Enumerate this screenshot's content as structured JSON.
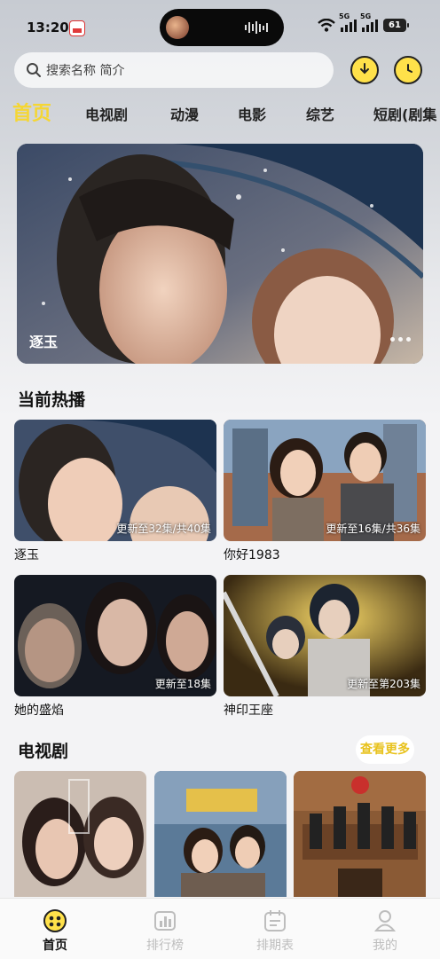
{
  "status_bar": {
    "time": "13:20",
    "network_1": "5G",
    "network_2": "5G",
    "battery": "61"
  },
  "search": {
    "placeholder": "搜索名称 简介"
  },
  "header_icons": [
    "download-icon",
    "history-icon"
  ],
  "tabs": [
    "首页",
    "电视剧",
    "动漫",
    "电影",
    "综艺",
    "短剧(剧集"
  ],
  "banner": {
    "title": "逐玉"
  },
  "now_playing": {
    "title": "当前热播",
    "items": [
      {
        "name": "逐玉",
        "update": "更新至32集/共40集"
      },
      {
        "name": "你好1983",
        "update": "更新至16集/共36集"
      },
      {
        "name": "她的盛焰",
        "update": "更新至18集"
      },
      {
        "name": "神印王座",
        "update": "更新至第203集"
      }
    ]
  },
  "tv_section": {
    "title": "电视剧",
    "more": "查看更多"
  },
  "bottom_nav": [
    "首页",
    "排行榜",
    "排期表",
    "我的"
  ],
  "colors": {
    "accent": "#f5d633",
    "accent_btn": "#ffe14a",
    "inactive": "#bdbdbd"
  }
}
